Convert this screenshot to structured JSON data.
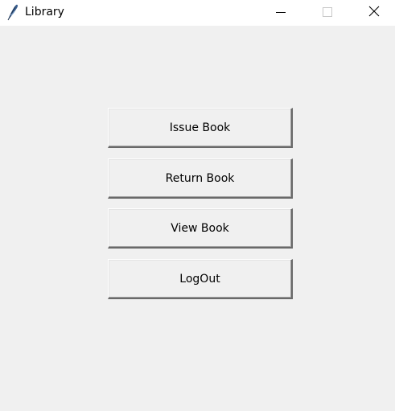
{
  "window": {
    "title": "Library",
    "icon": "feather-icon",
    "controls": {
      "minimize_icon": "minimize-icon",
      "maximize_icon": "maximize-icon",
      "close_icon": "close-icon"
    }
  },
  "menu": {
    "issue_label": "Issue Book",
    "return_label": "Return Book",
    "view_label": "View Book",
    "logout_label": "LogOut"
  },
  "colors": {
    "background": "#f0f0f0",
    "titlebar": "#ffffff",
    "button_face": "#f0f0f0",
    "button_shadow": "#696969"
  }
}
